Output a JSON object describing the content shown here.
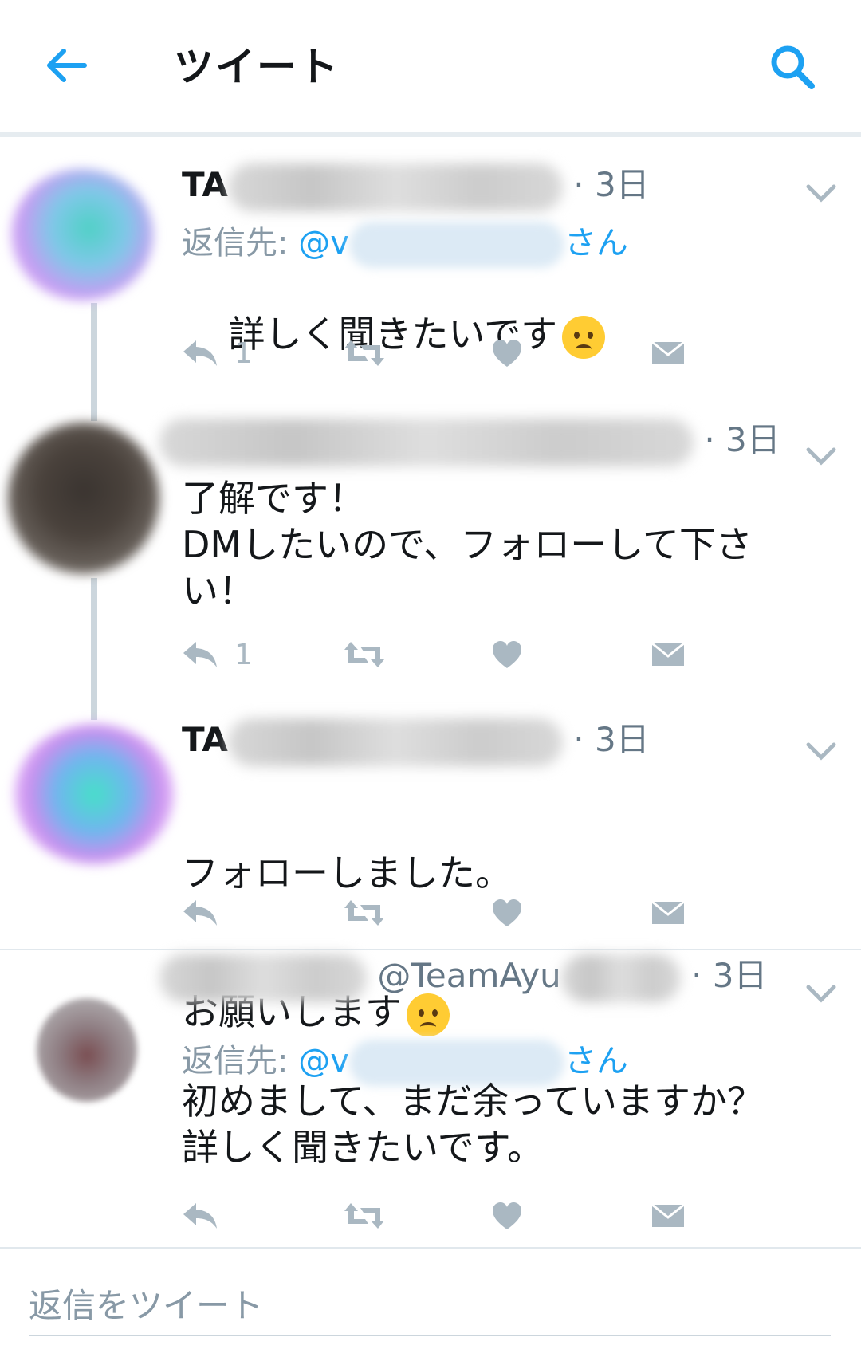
{
  "header": {
    "title": "ツイート"
  },
  "tweets": [
    {
      "name_visible": "TA",
      "time": "· 3日",
      "reply_label": "返信先:",
      "reply_prefix": "@v",
      "reply_suffix": "さん",
      "text": "詳しく聞きたいです",
      "reply_count": "1"
    },
    {
      "time": "· 3日",
      "text": "了解です！\nDMしたいので、フォローして下さい！",
      "reply_count": "1"
    },
    {
      "name_visible": "TA",
      "time": "· 3日",
      "text_line1": "フォローしました。",
      "text_line2": "お願いします"
    },
    {
      "handle_visible": "@TeamAyu",
      "time": "· 3日",
      "reply_label": "返信先:",
      "reply_prefix": "@v",
      "reply_suffix": "さん",
      "text": "初めまして、まだ余っていますか？\n詳しく聞きたいです。"
    }
  ],
  "compose": {
    "placeholder": "返信をツイート"
  },
  "colors": {
    "accent": "#1da1f2",
    "icon_gray": "#aab8c2",
    "text": "#14171a"
  }
}
